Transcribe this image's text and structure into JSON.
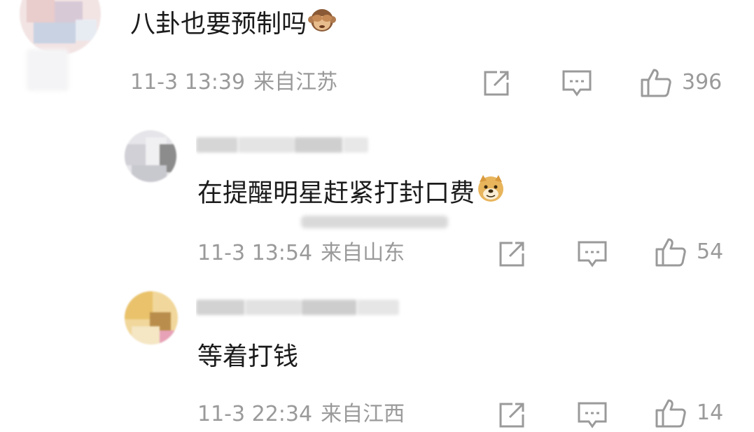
{
  "comments": [
    {
      "text": "八卦也要预制吗",
      "emoji": "see-no-evil-monkey",
      "date": "11-3 13:39",
      "location": "来自江苏",
      "likes": "396"
    },
    {
      "text": "在提醒明星赶紧打封口费",
      "emoji": "doge",
      "date": "11-3 13:54",
      "location": "来自山东",
      "likes": "54"
    },
    {
      "text": "等着打钱",
      "emoji": "",
      "date": "11-3 22:34",
      "location": "来自江西",
      "likes": "14"
    }
  ],
  "icons": {
    "share": "share-icon",
    "reply": "reply-icon",
    "like": "thumbs-up-icon"
  },
  "colors": {
    "meta": "#9a9a9a",
    "text": "#1b1b1b",
    "background": "#ffffff"
  }
}
